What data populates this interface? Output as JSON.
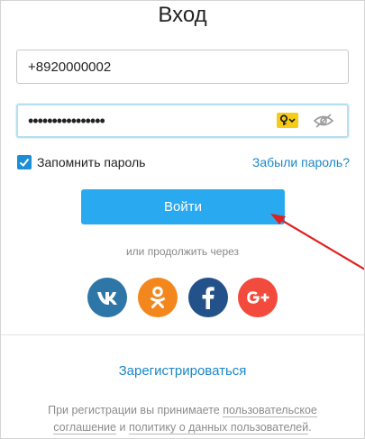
{
  "title": "Вход",
  "login_field": {
    "value": "+8920000002"
  },
  "password_field": {
    "value": "••••••••••••••••"
  },
  "remember": {
    "label": "Запомнить пароль",
    "checked": true
  },
  "forgot_link": "Забыли пароль?",
  "login_button": "Войти",
  "alt_login_text": "или продолжить через",
  "social": [
    {
      "name": "vk-icon",
      "color": "#2e76a8"
    },
    {
      "name": "odnoklassniki-icon",
      "color": "#f3871d"
    },
    {
      "name": "facebook-icon",
      "color": "#23518a"
    },
    {
      "name": "google-plus-icon",
      "color": "#f24a3c"
    }
  ],
  "register_link": "Зарегистрироваться",
  "terms": {
    "prefix": "При регистрации вы принимаете ",
    "agreement_link": "пользовательское соглашение",
    "middle": " и ",
    "policy_link": "политику о данных пользователей",
    "suffix": "."
  },
  "colors": {
    "accent": "#29aaf0",
    "link": "#1a87c7",
    "key_badge": "#f7cc16",
    "annotation_arrow": "#e0201f"
  }
}
